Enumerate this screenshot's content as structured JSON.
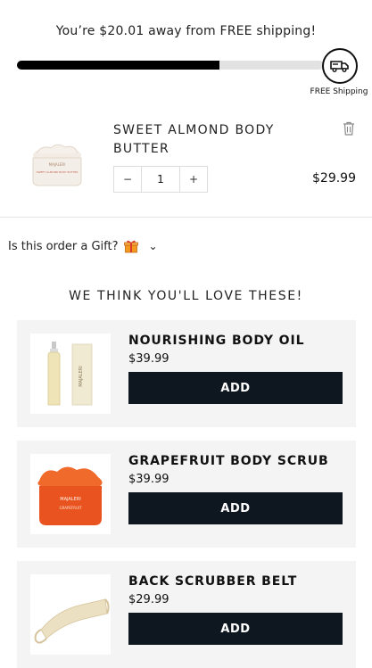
{
  "shipping": {
    "prefix": "You’re ",
    "amount": "$20.01",
    "suffix": " away from FREE shipping!",
    "progress": 0.66,
    "icon_label": "FREE Shipping"
  },
  "cart": {
    "item_name": "SWEET ALMOND BODY BUTTER",
    "jar_brand": "MAJALERI",
    "jar_text": "SWEET ALMOND BODY BUTTER",
    "quantity": "1",
    "minus": "−",
    "plus": "+",
    "price": "$29.99"
  },
  "gift": {
    "label": "Is this order a Gift?",
    "chevron": "⌄"
  },
  "recommendations": {
    "heading": "WE THINK YOU'LL LOVE THESE!",
    "items": [
      {
        "name": "NOURISHING BODY OIL",
        "price": "$39.99",
        "add_label": "ADD"
      },
      {
        "name": "GRAPEFRUIT BODY SCRUB",
        "price": "$39.99",
        "add_label": "ADD"
      },
      {
        "name": "BACK SCRUBBER BELT",
        "price": "$29.99",
        "add_label": "ADD"
      }
    ]
  },
  "colors": {
    "progress_fill": "#000000",
    "button_bg": "#0e171f",
    "card_bg": "#f4f4f5",
    "scrub_orange": "#e8531f"
  }
}
